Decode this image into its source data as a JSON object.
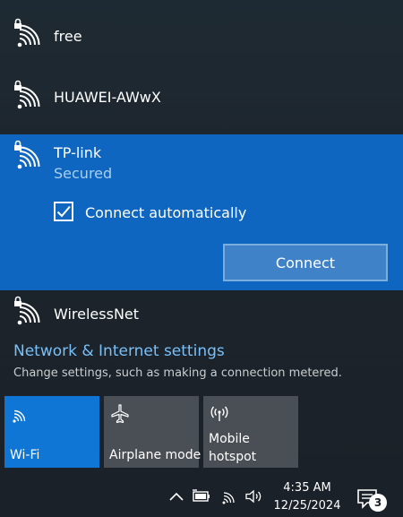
{
  "networks": [
    {
      "ssid": "free",
      "secured": true
    },
    {
      "ssid": "HUAWEI-AWwX",
      "secured": true
    },
    {
      "ssid": "TP-link",
      "status": "Secured",
      "connect_automatically_label": "Connect automatically",
      "connect_automatically_checked": true,
      "connect_button_label": "Connect",
      "selected": true
    },
    {
      "ssid": "WirelessNet",
      "secured": true
    }
  ],
  "settings": {
    "link_label": "Network & Internet settings",
    "description": "Change settings, such as making a connection metered."
  },
  "quick_actions": [
    {
      "label": "Wi-Fi",
      "icon": "wifi-icon",
      "active": true
    },
    {
      "label": "Airplane mode",
      "icon": "airplane-icon",
      "active": false
    },
    {
      "label_line1": "Mobile",
      "label_line2": "hotspot",
      "icon": "hotspot-icon",
      "active": false
    }
  ],
  "taskbar": {
    "time": "4:35 AM",
    "date": "12/25/2024",
    "notification_count": "3",
    "icons": [
      "chevron-up-icon",
      "battery-icon",
      "wifi-icon",
      "volume-icon",
      "action-center-icon"
    ]
  },
  "colors": {
    "accent": "#0f66c0",
    "active_tile": "#0f76d6",
    "link": "#79c0f8",
    "inactive_tile": "#4a4f55",
    "background": "#1b2128"
  }
}
